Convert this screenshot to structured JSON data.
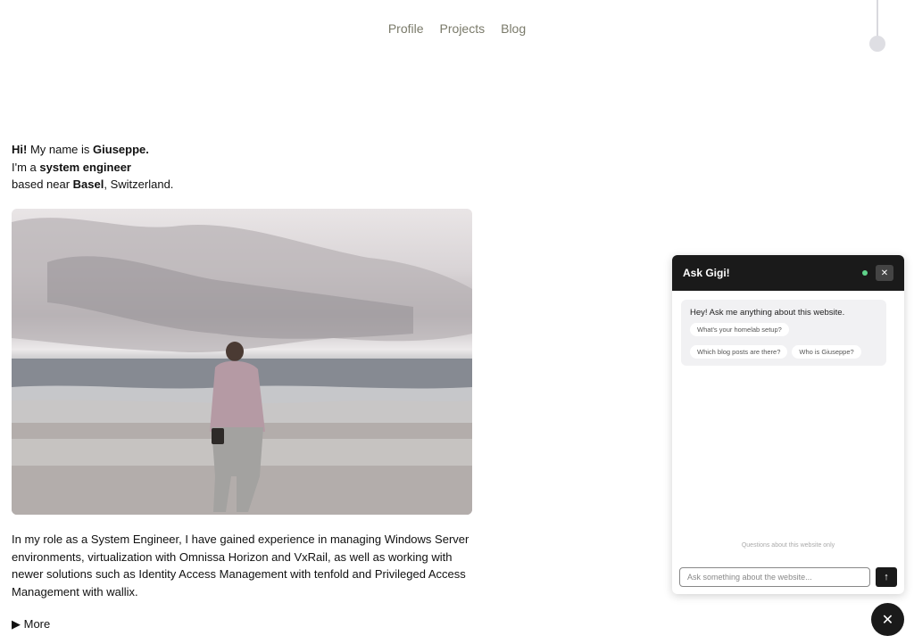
{
  "nav": {
    "items": [
      {
        "label": "Profile"
      },
      {
        "label": "Projects"
      },
      {
        "label": "Blog"
      }
    ]
  },
  "intro": {
    "hi": "Hi!",
    "my_name_is": " My name is ",
    "name": "Giuseppe.",
    "im_a": "I'm a ",
    "role": "system engineer",
    "based_near": "based near ",
    "city": "Basel",
    "country": ", Switzerland."
  },
  "hero": {
    "alt": "Person walking on a beach toward the sea"
  },
  "bio": {
    "text": "In my role as a System Engineer, I have gained experience in managing Windows Server environments, virtualization with Omnissa Horizon and VxRail, as well as working with newer solutions such as Identity Access Management with tenfold and Privileged Access Management with wallix.",
    "more_label": "▶ More"
  },
  "chat": {
    "title": "Ask Gigi!",
    "close_glyph": "✕",
    "greeting": "Hey! Ask me anything about this website.",
    "suggestions": [
      "What's your homelab setup?",
      "Which blog posts are there?",
      "Who is Giuseppe?"
    ],
    "footer_note": "Questions about this website only",
    "input_placeholder": "Ask something about the website...",
    "send_glyph": "↑",
    "status_color": "#5fd38a"
  },
  "fab": {
    "glyph": "✕"
  }
}
